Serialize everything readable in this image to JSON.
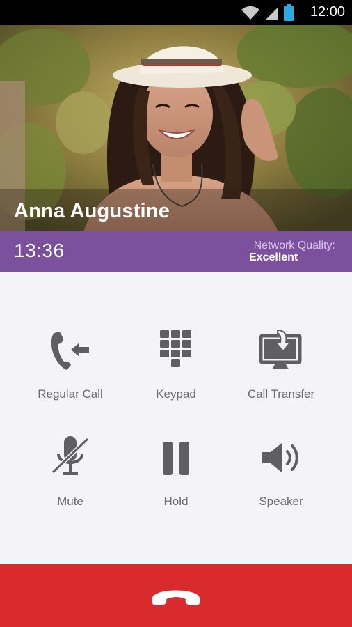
{
  "status_bar": {
    "time": "12:00",
    "icons": [
      "wifi-icon",
      "signal-icon",
      "battery-icon"
    ]
  },
  "contact": {
    "name": "Anna Augustine",
    "photo": "contact-photo"
  },
  "call": {
    "duration": "13:36",
    "network_quality_label": "Network Quality:",
    "network_quality_value": "Excellent"
  },
  "actions": [
    {
      "label": "Regular Call",
      "icon": "regular-call-icon"
    },
    {
      "label": "Keypad",
      "icon": "keypad-icon"
    },
    {
      "label": "Call Transfer",
      "icon": "call-transfer-icon"
    },
    {
      "label": "Mute",
      "icon": "mute-icon"
    },
    {
      "label": "Hold",
      "icon": "hold-icon"
    },
    {
      "label": "Speaker",
      "icon": "speaker-icon"
    }
  ],
  "end_call": {
    "icon": "end-call-icon"
  },
  "colors": {
    "purple": "#7b519d",
    "end_call_red": "#d92b2e",
    "icon_gray": "#5f5f63",
    "background": "#f4f3f8"
  }
}
